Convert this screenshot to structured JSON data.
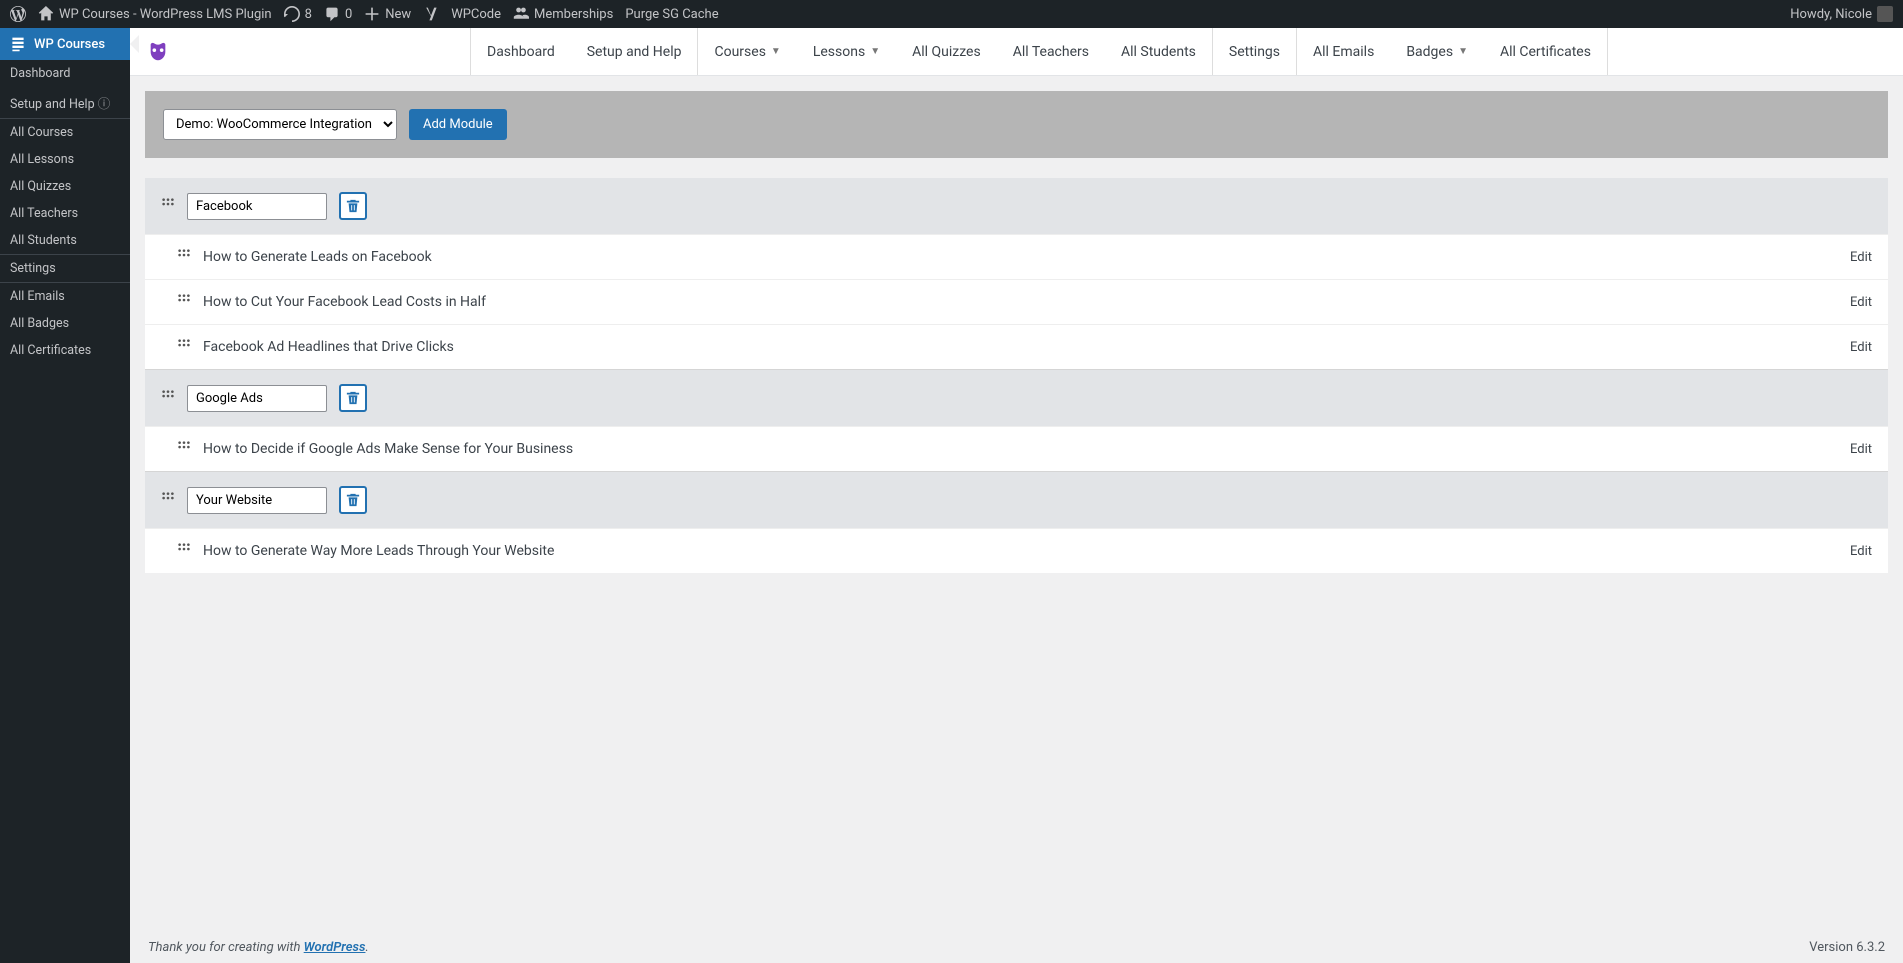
{
  "wpbar": {
    "site_title": "WP Courses - WordPress LMS Plugin",
    "updates": "8",
    "comments": "0",
    "new": "New",
    "wpcode": "WPCode",
    "memberships": "Memberships",
    "purge": "Purge SG Cache",
    "howdy": "Howdy, Nicole"
  },
  "adminmenu": {
    "main": "WP Courses",
    "items": [
      "Dashboard",
      "Setup and Help",
      "All Courses",
      "All Lessons",
      "All Quizzes",
      "All Teachers",
      "All Students",
      "Settings",
      "All Emails",
      "All Badges",
      "All Certificates"
    ]
  },
  "pluginnav": {
    "items": [
      {
        "label": "Dashboard",
        "dropdown": false,
        "sep_before": true
      },
      {
        "label": "Setup and Help",
        "dropdown": false,
        "sep_before": false
      },
      {
        "label": "Courses",
        "dropdown": true,
        "sep_before": true
      },
      {
        "label": "Lessons",
        "dropdown": true,
        "sep_before": false
      },
      {
        "label": "All Quizzes",
        "dropdown": false,
        "sep_before": false
      },
      {
        "label": "All Teachers",
        "dropdown": false,
        "sep_before": false
      },
      {
        "label": "All Students",
        "dropdown": false,
        "sep_before": false
      },
      {
        "label": "Settings",
        "dropdown": false,
        "sep_before": true
      },
      {
        "label": "All Emails",
        "dropdown": false,
        "sep_before": true
      },
      {
        "label": "Badges",
        "dropdown": true,
        "sep_before": false
      },
      {
        "label": "All Certificates",
        "dropdown": false,
        "sep_before": false
      }
    ]
  },
  "toolbar": {
    "course_selected": "Demo: WooCommerce Integration",
    "add_module": "Add Module"
  },
  "modules": [
    {
      "name": "Facebook",
      "lessons": [
        "How to Generate Leads on Facebook",
        "How to Cut Your Facebook Lead Costs in Half",
        "Facebook Ad Headlines that Drive Clicks"
      ]
    },
    {
      "name": "Google Ads",
      "lessons": [
        "How to Decide if Google Ads Make Sense for Your Business"
      ]
    },
    {
      "name": "Your Website",
      "lessons": [
        "How to Generate Way More Leads Through Your Website"
      ]
    }
  ],
  "edit_label": "Edit",
  "footer": {
    "thanks": "Thank you for creating with ",
    "wp": "WordPress",
    "version": "Version 6.3.2"
  }
}
